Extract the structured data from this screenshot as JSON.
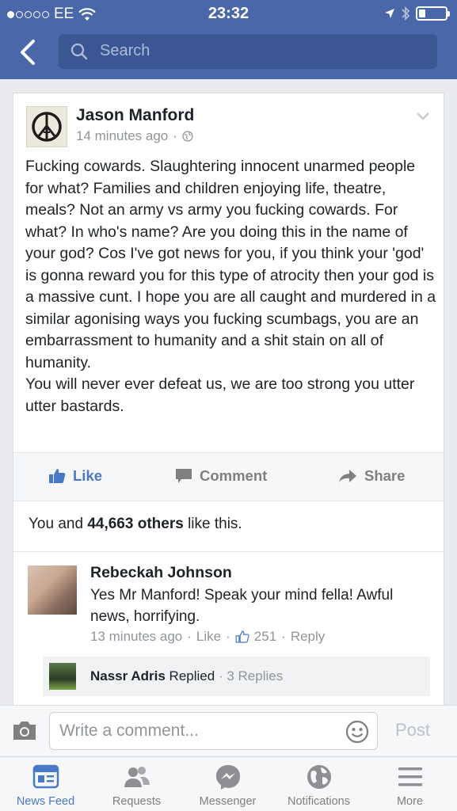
{
  "status_bar": {
    "signal_dots_filled": 1,
    "signal_dots_total": 5,
    "carrier": "EE",
    "time": "23:32",
    "battery_level": 0.25
  },
  "nav": {
    "search_placeholder": "Search"
  },
  "post": {
    "author": "Jason Manford",
    "timestamp": "14 minutes ago",
    "body": "Fucking cowards. Slaughtering innocent unarmed people for what? Families and children enjoying life, theatre, meals? Not an army vs army you fucking cowards. For what? In who's name? Are you doing this in the name of your god? Cos I've got news for you, if you think your 'god' is gonna reward you for this type of atrocity then your god is a massive cunt. I hope you are all caught and murdered in a similar agonising ways you fucking scumbags, you are an embarrassment to humanity and a shit stain on all of humanity.\nYou will never ever defeat us, we are too strong you utter utter bastards.",
    "actions": {
      "like": "Like",
      "comment": "Comment",
      "share": "Share"
    },
    "likes_prefix": "You and ",
    "likes_count": "44,663 others",
    "likes_suffix": " like this."
  },
  "comment": {
    "author": "Rebeckah Johnson",
    "text": "Yes Mr Manford! Speak your mind fella! Awful news, horrifying.",
    "timestamp": "13 minutes ago",
    "like_label": "Like",
    "like_count": "251",
    "reply_label": "Reply",
    "replies": {
      "author": "Nassr Adris",
      "action": "Replied",
      "count": "3 Replies"
    }
  },
  "composer": {
    "placeholder": "Write a comment...",
    "post_label": "Post"
  },
  "tabs": [
    {
      "label": "News Feed",
      "icon": "news-feed-icon",
      "active": true
    },
    {
      "label": "Requests",
      "icon": "friend-requests-icon",
      "active": false
    },
    {
      "label": "Messenger",
      "icon": "messenger-icon",
      "active": false
    },
    {
      "label": "Notifications",
      "icon": "globe-icon",
      "active": false
    },
    {
      "label": "More",
      "icon": "menu-icon",
      "active": false
    }
  ],
  "colors": {
    "brand_blue": "#4a68a9",
    "search_bg": "#3a5794",
    "active_blue": "#4a78c8",
    "muted_grey": "#90949c"
  }
}
